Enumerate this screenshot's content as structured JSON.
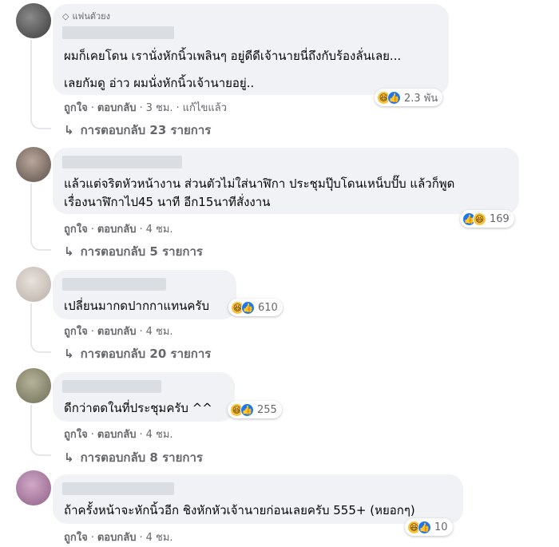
{
  "comments": [
    {
      "badge": "แฟนตัวยง",
      "lines": [
        "ผมก็เคยโดน เรานั่งหักนิ้วเพลินๆ อยู่ดีดีเจ้านายนี่ถึงกับร้องลั่นเลย...",
        "เลยกัมดู อ่าว ผมนั่งหักนิ้วเจ้านายอยู่.."
      ],
      "reaction_count": "2.3 พัน",
      "reaction_icons": [
        "haha-icon",
        "like-icon"
      ],
      "like_label": "ถูกใจ",
      "reply_label": "ตอบกลับ",
      "time": "3 ชม.",
      "edited": "แก้ไขแล้ว",
      "replies_label": "การตอบกลับ 23 รายการ"
    },
    {
      "lines": [
        "แล้วแต่จริตหัวหน้างาน ส่วนตัวไม่ใส่นาฬิกา ประชุมปุ๊บโดนเหน็บปั๊บ แล้วก็พูด",
        "เรื่องนาฬิกาไป45 นาที อีก15นาทีสั่งงาน"
      ],
      "reaction_count": "169",
      "reaction_icons": [
        "like-icon",
        "haha-icon"
      ],
      "like_label": "ถูกใจ",
      "reply_label": "ตอบกลับ",
      "time": "4 ชม.",
      "replies_label": "การตอบกลับ 5 รายการ"
    },
    {
      "lines": [
        "เปลี่ยนมากดปากกาแทนครับ"
      ],
      "reaction_count": "610",
      "reaction_icons": [
        "haha-icon",
        "like-icon"
      ],
      "like_label": "ถูกใจ",
      "reply_label": "ตอบกลับ",
      "time": "4 ชม.",
      "replies_label": "การตอบกลับ 20 รายการ"
    },
    {
      "lines": [
        "ดีกว่าตดในที่ประชุมครับ ^^"
      ],
      "reaction_count": "255",
      "reaction_icons": [
        "haha-icon",
        "like-icon"
      ],
      "like_label": "ถูกใจ",
      "reply_label": "ตอบกลับ",
      "time": "4 ชม.",
      "replies_label": "การตอบกลับ 8 รายการ"
    },
    {
      "lines": [
        "ถ้าครั้งหน้าจะหักนิ้วอีก ชิงหักหัวเจ้านายก่อนเลยครับ 555+ (หยอกๆ)"
      ],
      "reaction_count": "10",
      "reaction_icons": [
        "haha-icon",
        "like-icon"
      ],
      "like_label": "ถูกใจ",
      "reply_label": "ตอบกลับ",
      "time": "4 ชม."
    }
  ],
  "colors": {
    "bubble": "#f0f2f5",
    "meta_text": "#65676b",
    "like_blue": "#1877f2",
    "haha_yellow": "#f7c23a"
  }
}
